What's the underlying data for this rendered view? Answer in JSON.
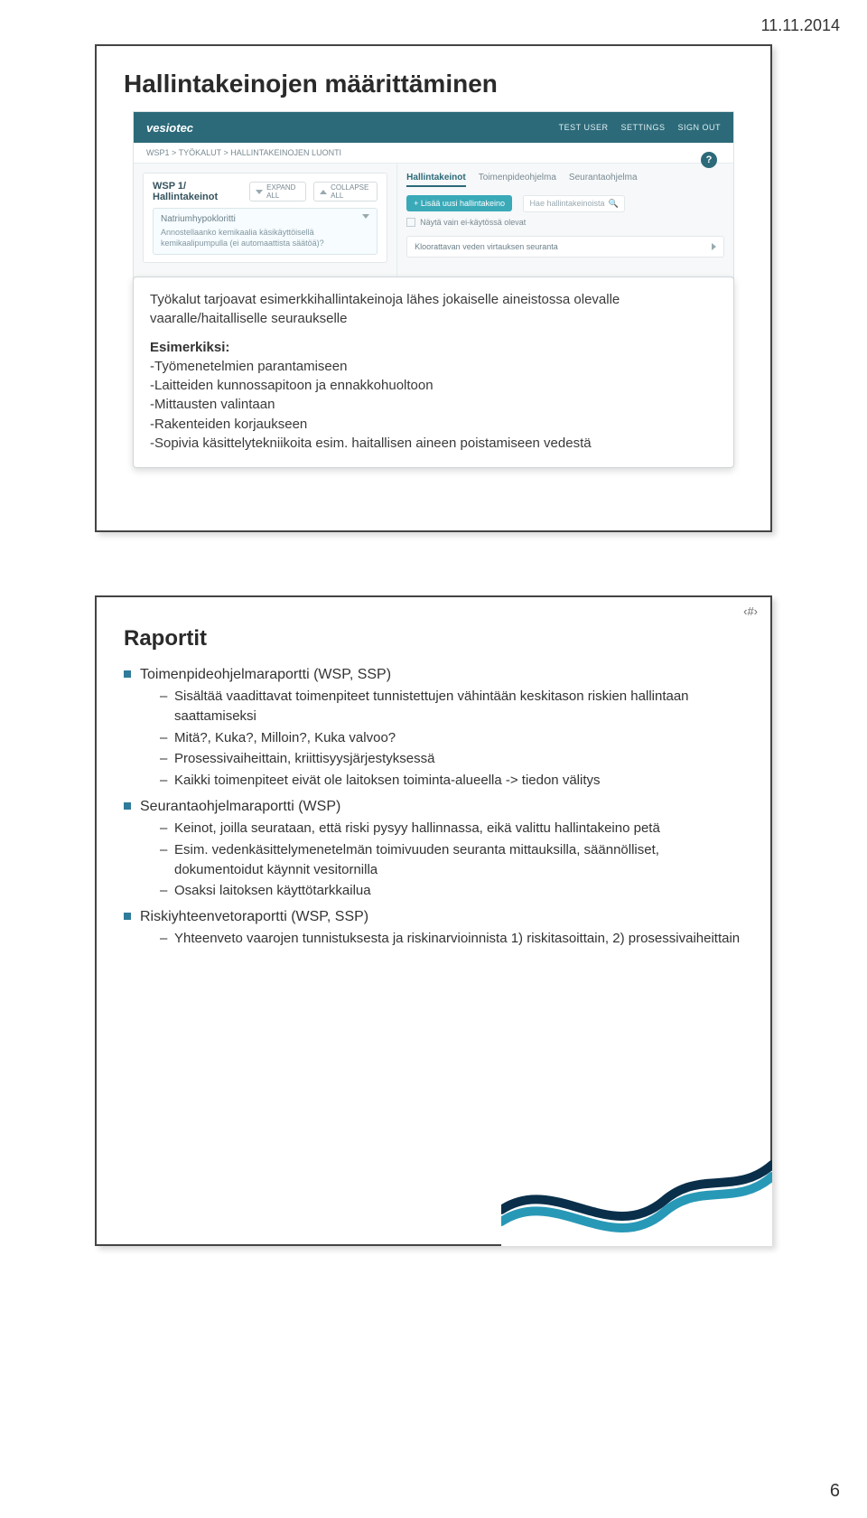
{
  "header": {
    "date": "11.11.2014"
  },
  "footer": {
    "page_number": "6"
  },
  "frame1": {
    "title": "Hallintakeinojen määrittäminen",
    "screenshot": {
      "logo": "vesiotec",
      "topbar": {
        "user": "TEST USER",
        "settings": "SETTINGS",
        "signout": "SIGN OUT"
      },
      "breadcrumb": "WSP1  >  TYÖKALUT  >  HALLINTAKEINOJEN LUONTI",
      "help_badge": "?",
      "left": {
        "card_title": "WSP 1/ Hallintakeinot",
        "expand": "EXPAND ALL",
        "collapse": "COLLAPSE ALL",
        "sub_title": "Natriumhypokloritti",
        "sub_text": "Annostellaanko kemikaalia käsikäyttöisellä kemikaalipumpulla (ei automaattista säätöä)?"
      },
      "right": {
        "tabs": [
          "Hallintakeinot",
          "Toimenpideohjelma",
          "Seurantaohjelma"
        ],
        "add_button": "+ Lisää uusi hallintakeino",
        "search_placeholder": "Hae hallintakeinoista",
        "checkbox_label": "Näytä vain ei-käytössä olevat",
        "item_label": "Kloorattavan veden virtauksen seuranta"
      }
    },
    "callout": {
      "p1": "Työkalut tarjoavat esimerkkihallintakeinoja lähes jokaiselle aineistossa olevalle vaaralle/haitalliselle seuraukselle",
      "p2_head": "Esimerkiksi:",
      "p2_body": "-Työmenetelmien parantamiseen\n-Laitteiden kunnossapitoon ja ennakkohuoltoon\n-Mittausten valintaan\n-Rakenteiden korjaukseen\n-Sopivia käsittelytekniikoita esim. haitallisen aineen poistamiseen vedestä"
    }
  },
  "frame2": {
    "corner_tag": "‹#›",
    "title": "Raportit",
    "items": [
      {
        "text": "Toimenpideohjelmaraportti (WSP, SSP)",
        "sub": [
          "Sisältää vaadittavat toimenpiteet tunnistettujen vähintään keskitason riskien hallintaan saattamiseksi",
          "Mitä?, Kuka?, Milloin?, Kuka valvoo?",
          "Prosessivaiheittain, kriittisyysjärjestyksessä",
          "Kaikki toimenpiteet eivät ole laitoksen toiminta-alueella -> tiedon välitys"
        ]
      },
      {
        "text": "Seurantaohjelmaraportti (WSP)",
        "sub": [
          "Keinot, joilla seurataan, että riski pysyy hallinnassa, eikä valittu hallintakeino petä",
          "Esim. vedenkäsittelymenetelmän toimivuuden seuranta mittauksilla, säännölliset, dokumentoidut käynnit vesitornilla",
          "Osaksi laitoksen käyttötarkkailua"
        ]
      },
      {
        "text": "Riskiyhteenvetoraportti (WSP, SSP)",
        "sub": [
          "Yhteenveto vaarojen tunnistuksesta ja riskinarvioinnista 1) riskitasoittain, 2) prosessivaiheittain"
        ]
      }
    ]
  }
}
